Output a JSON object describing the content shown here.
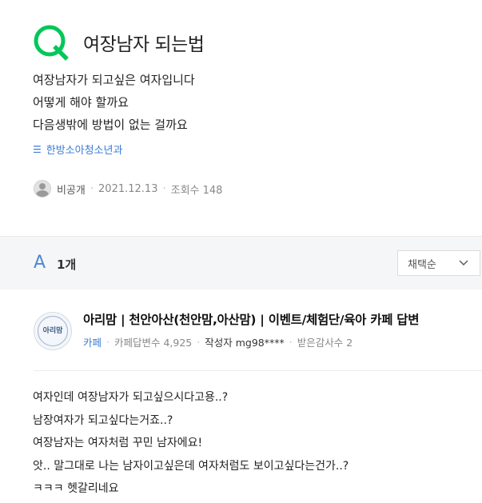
{
  "question": {
    "icon": "q-letter-icon",
    "title": "여장남자 되는법",
    "lines": [
      "여장남자가 되고싶은 여자입니다",
      "어떻게 해야 할까요",
      "다음생밖에 방법이 없는 걸까요"
    ],
    "category": "한방소아청소년과",
    "author": "비공개",
    "date": "2021.12.13",
    "views": "조회수 148"
  },
  "answers_header": {
    "letter": "A",
    "count": "1개",
    "sort_label": "채택순"
  },
  "answer": {
    "logo_text": "아리맘",
    "cafe_name": "아리맘  |  천안아산(천안맘,아산맘)  |  이벤트/체험단/육아 카페 답변",
    "source_type": "카페",
    "answer_count": "카페답변수 4,925",
    "author_label": "작성자 mg98****",
    "thanks": "받은감사수 2",
    "lines": [
      "여자인데 여장남자가 되고싶으시다고용..?",
      "남장여자가 되고싶다는거죠..?",
      "여장남자는 여자처럼 꾸민 남자에요!",
      "앗.. 말그대로 나는 남자이고싶은데 여자처럼도 보이고싶다는건가..?",
      "ㅋㅋㅋ 헷갈리네요"
    ]
  },
  "colors": {
    "accent_green": "#03c75a",
    "link_blue": "#3a7bd5"
  }
}
